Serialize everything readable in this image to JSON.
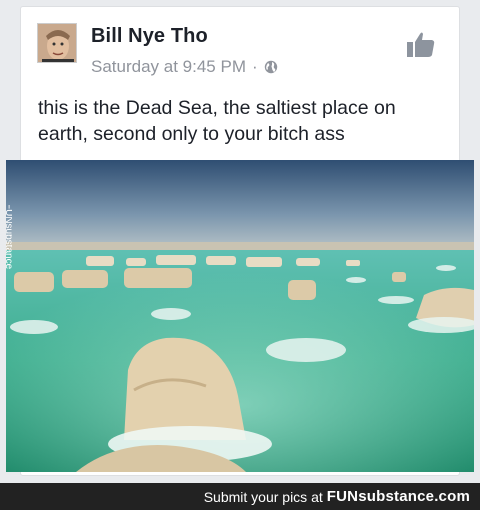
{
  "post": {
    "author": "Bill Nye Tho",
    "timestamp": "Saturday at 9:45 PM",
    "separator": "·",
    "text": "this is the Dead Sea, the saltiest place on earth, second only to your bitch ass"
  },
  "icons": {
    "privacy": "globe-icon",
    "reaction": "thumbs-up-icon"
  },
  "watermark": {
    "side": "FUNsubstance",
    "footer_prefix": "Submit your pics at",
    "footer_brand": "FUNsubstance.com"
  },
  "colors": {
    "name": "#1d2129",
    "meta": "#90949c",
    "icon": "#8d949e"
  }
}
